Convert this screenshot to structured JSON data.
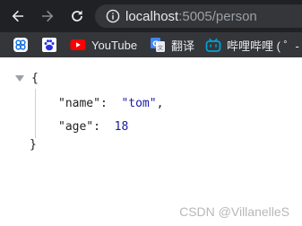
{
  "toolbar": {
    "back_icon": "arrow-left-icon",
    "forward_icon": "arrow-right-icon",
    "reload_icon": "reload-icon",
    "site_info_icon": "info-icon",
    "url_host": "localhost",
    "url_rest": ":5005/person"
  },
  "bookmarks": [
    {
      "icon": "bookmark-grid-icon",
      "label": ""
    },
    {
      "icon": "baidu-paw-icon",
      "label": ""
    },
    {
      "icon": "youtube-icon",
      "label": "YouTube"
    },
    {
      "icon": "google-translate-icon",
      "label": "翻译"
    },
    {
      "icon": "bilibili-icon",
      "label": "哔哩哔哩 ( ゜- ゜)"
    }
  ],
  "json_view": {
    "open_brace": "{",
    "close_brace": "}",
    "entries": [
      {
        "key": "\"name\"",
        "value": "\"tom\"",
        "trailing": ","
      },
      {
        "key": "\"age\"",
        "value": "18",
        "trailing": ""
      }
    ],
    "colon": ":"
  },
  "watermark": "CSDN @VillanelleS",
  "colors": {
    "toolbar_bg": "#202124",
    "bookmarks_bg": "#35363a",
    "omnibox_bg": "#35363a",
    "value_color": "#1a1aa6",
    "youtube_red": "#ff0000",
    "baidu_blue": "#2932e1",
    "bilibili_blue": "#00a1d6"
  }
}
